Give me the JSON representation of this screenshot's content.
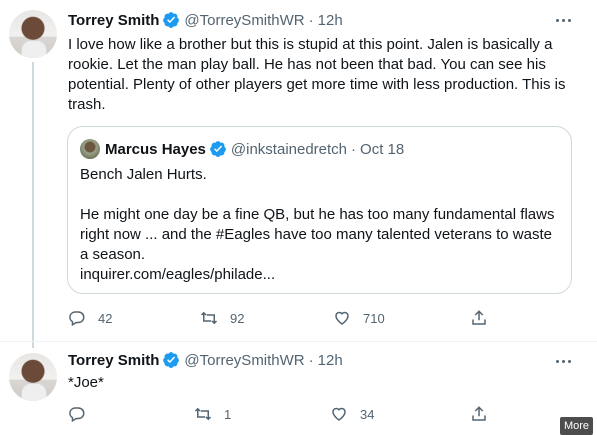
{
  "tweets": [
    {
      "name": "Torrey Smith",
      "handle": "@TorreySmithWR",
      "sep": "·",
      "time": "12h",
      "text": "I love how like a brother but this is stupid at this point. Jalen is basically a rookie. Let the man play ball. He has not been that bad. You can see his potential. Plenty of other players get more time with less production. This is trash.",
      "replies": "42",
      "retweets": "92",
      "likes": "710"
    },
    {
      "name": "Torrey Smith",
      "handle": "@TorreySmithWR",
      "sep": "·",
      "time": "12h",
      "text": "*Joe*",
      "replies": "",
      "retweets": "1",
      "likes": "34"
    }
  ],
  "quote": {
    "name": "Marcus Hayes",
    "handle": "@inkstainedretch",
    "sep": "·",
    "time": "Oct 18",
    "line1": "Bench Jalen Hurts.",
    "line2": "He might one day be a fine QB, but he has too many fundamental flaws right now ... and the #Eagles have too many talented veterans to waste a season.",
    "link": "inquirer.com/eagles/philade..."
  },
  "overlay": {
    "more_label": "More"
  },
  "colors": {
    "verified": "#1d9bf0",
    "text": "#0f1419",
    "secondary": "#536471",
    "border": "#cfd9de"
  }
}
